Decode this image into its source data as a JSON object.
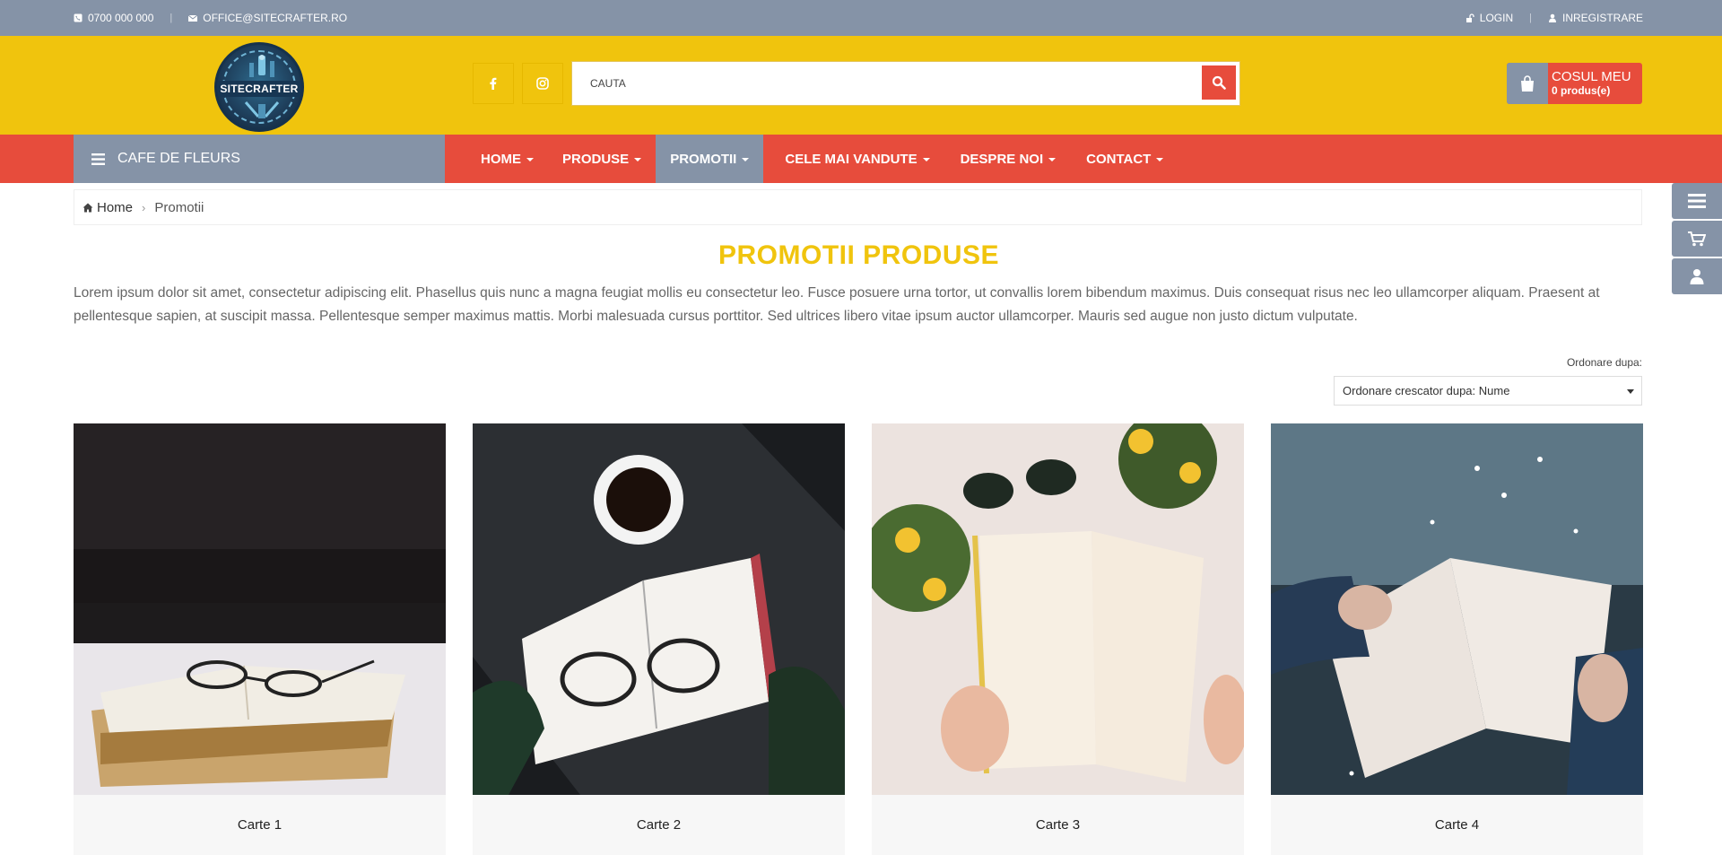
{
  "topbar": {
    "phone": "0700 000 000",
    "email": "OFFICE@SITECRAFTER.RO",
    "login": "LOGIN",
    "register": "INREGISTRARE"
  },
  "header": {
    "logo_text": "SITECRAFTER",
    "search_placeholder": "CAUTA",
    "cart_title": "COSUL MEU",
    "cart_count": "0 produs(e)"
  },
  "nav": {
    "category_button": "CAFE DE FLEURS",
    "items": [
      {
        "label": "HOME"
      },
      {
        "label": "PRODUSE"
      },
      {
        "label": "PROMOTII"
      },
      {
        "label": "CELE MAI VANDUTE"
      },
      {
        "label": "DESPRE NOI"
      },
      {
        "label": "CONTACT"
      }
    ]
  },
  "breadcrumb": {
    "home": "Home",
    "current": "Promotii"
  },
  "page": {
    "title": "PROMOTII PRODUSE",
    "intro": "Lorem ipsum dolor sit amet, consectetur adipiscing elit. Phasellus quis nunc a magna feugiat mollis eu consectetur leo. Fusce posuere urna tortor, ut convallis lorem bibendum maximus. Duis consequat risus nec leo ullamcorper aliquam. Praesent at pellentesque sapien, at suscipit massa. Pellentesque semper maximus mattis. Morbi malesuada cursus porttitor. Sed ultrices libero vitae ipsum auctor ullamcorper. Mauris sed augue non justo dictum vulputate.",
    "sort_label": "Ordonare dupa:",
    "sort_value": "Ordonare crescator dupa: Nume"
  },
  "products": [
    {
      "name": "Carte 1"
    },
    {
      "name": "Carte 2"
    },
    {
      "name": "Carte 3"
    },
    {
      "name": "Carte 4"
    }
  ],
  "colors": {
    "topbar": "#8593a7",
    "header": "#f0c40d",
    "nav": "#e74c3c",
    "accent_title": "#f0c40d"
  },
  "icons": [
    "phone-icon",
    "envelope-icon",
    "unlock-icon",
    "user-icon",
    "facebook-icon",
    "instagram-icon",
    "search-icon",
    "shopping-bag-icon",
    "bars-icon",
    "home-icon",
    "chevron-right-icon",
    "cart-icon"
  ]
}
